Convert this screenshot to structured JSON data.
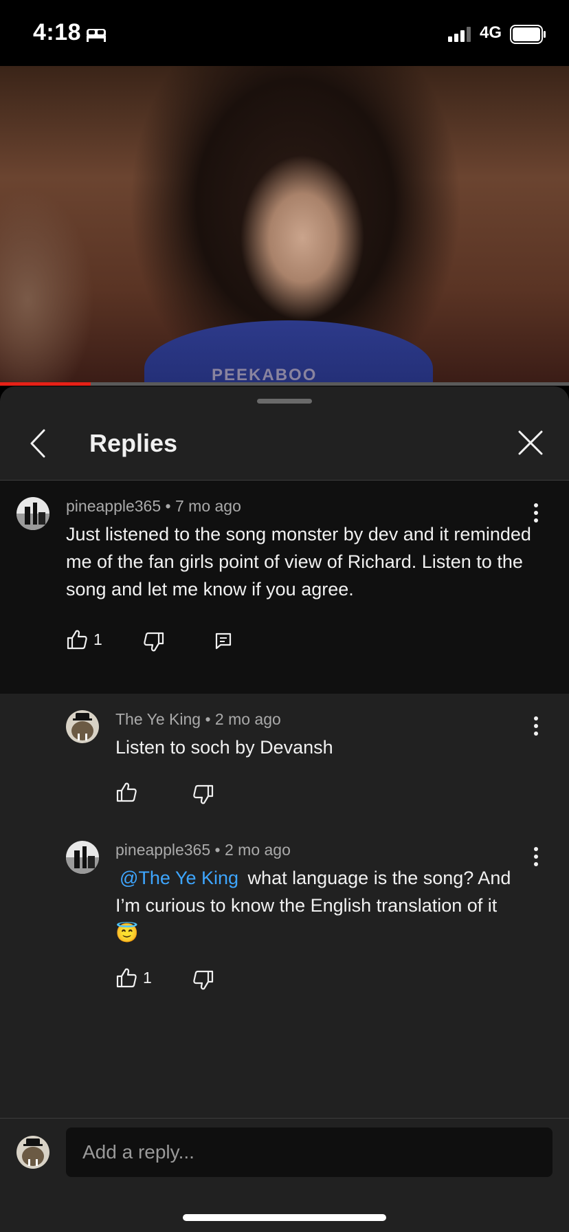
{
  "status_bar": {
    "time": "4:18",
    "network": "4G",
    "icons": [
      "bed-icon",
      "signal-icon",
      "battery-icon"
    ]
  },
  "video": {
    "watermark": "PEEKABOO",
    "progress_percent": 16,
    "progress_color": "#e62117"
  },
  "panel": {
    "title": "Replies",
    "back_icon": "chevron-left-icon",
    "close_icon": "close-icon"
  },
  "parent_comment": {
    "author": "pineapple365",
    "age": "7 mo ago",
    "text": "Just listened to the song monster by dev and it reminded me of the fan girls point of view of Richard. Listen to the song and let me know if you agree.",
    "likes": "1"
  },
  "replies": [
    {
      "author": "The Ye King",
      "age": "2 mo ago",
      "text": "Listen to soch by Devansh",
      "likes": ""
    },
    {
      "author": "pineapple365",
      "age": "2 mo ago",
      "mention": "@The Ye King",
      "text": " what language is the song? And I’m curious to know the English translation of it 😇",
      "likes": "1"
    }
  ],
  "separator": "•",
  "reply_box": {
    "placeholder": "Add a reply..."
  },
  "colors": {
    "panel_bg": "#212121",
    "parent_bg": "#101010",
    "mention": "#3ea6ff"
  }
}
